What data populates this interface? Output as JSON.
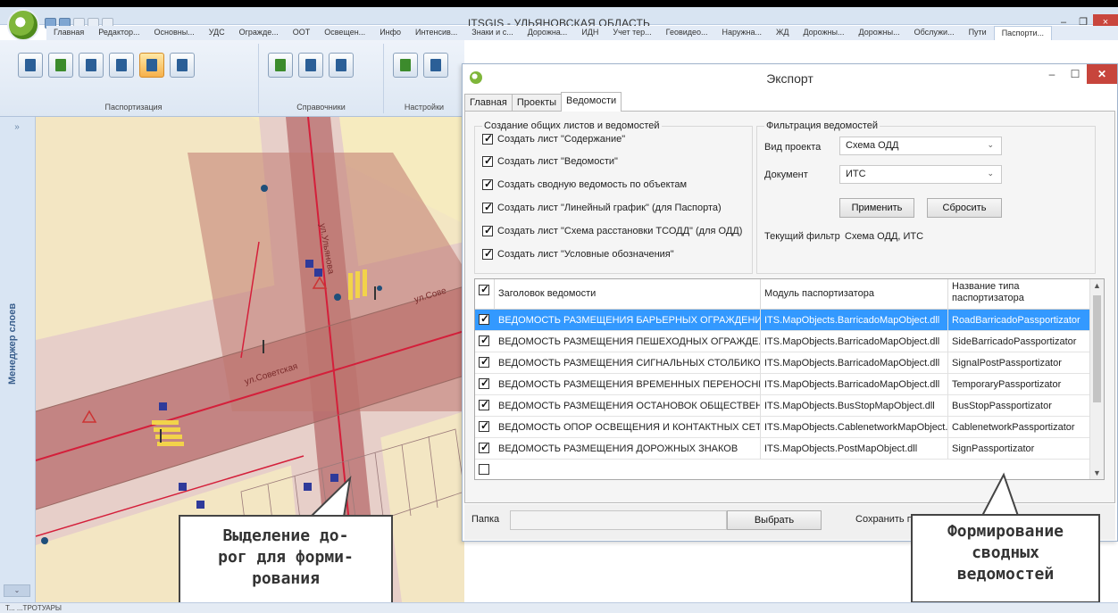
{
  "app": {
    "title": "ITSGIS - УЛЬЯНОВСКАЯ ОБЛАСТЬ",
    "window_controls": {
      "minimize": "–",
      "restore": "❐",
      "close": "×"
    }
  },
  "ribbon_tabs": [
    "Главная",
    "Редактор...",
    "Основны...",
    "УДС",
    "Огражде...",
    "ООТ",
    "Освещен...",
    "Инфо",
    "Интенсив...",
    "Знаки и с...",
    "Дорожна...",
    "ИДН",
    "Учет тер...",
    "Геовидео...",
    "Наружна...",
    "ЖД",
    "Дорожны...",
    "Дорожны...",
    "Обслужи...",
    "Пути",
    "Паспорти..."
  ],
  "ribbon_groups": {
    "passport": "Паспортизация",
    "refs": "Справочники",
    "settings": "Настройки"
  },
  "layers_panel": {
    "title": "Менеджер слоев",
    "toggle": "»"
  },
  "map": {
    "labels": {
      "street_ulyanova": "ул.Ульянова",
      "street_sovetskaya": "ул.Советская",
      "street_sove_right": "ул.Сове"
    }
  },
  "export_dialog": {
    "title": "Экспорт",
    "tabs": [
      "Главная",
      "Проекты",
      "Ведомости"
    ],
    "active_tab": "Ведомости",
    "common_group": {
      "legend": "Создание общих листов и ведомостей",
      "options": [
        {
          "label": "Создать лист \"Содержание\"",
          "checked": true
        },
        {
          "label": "Создать лист \"Ведомости\"",
          "checked": true
        },
        {
          "label": "Создать сводную ведомость по объектам",
          "checked": true
        },
        {
          "label": "Создать лист \"Линейный график\" (для Паспорта)",
          "checked": true
        },
        {
          "label": "Создать лист \"Схема расстановки ТСОДД\" (для ОДД)",
          "checked": true
        },
        {
          "label": "Создать лист \"Условные обозначения\"",
          "checked": true
        }
      ]
    },
    "filter_group": {
      "legend": "Фильтрация ведомостей",
      "project_type_label": "Вид проекта",
      "project_type_value": "Схема ОДД",
      "document_label": "Документ",
      "document_value": "ИТС",
      "apply_label": "Применить",
      "reset_label": "Сбросить",
      "current_filter_label": "Текущий фильтр",
      "current_filter_value": "Схема ОДД, ИТС"
    },
    "table": {
      "columns": [
        "Заголовок ведомости",
        "Модуль паспортизатора",
        "Название типа паспортизатора"
      ],
      "rows": [
        {
          "checked": true,
          "title": "ВЕДОМОСТЬ РАЗМЕЩЕНИЯ БАРЬЕРНЫХ ОГРАЖДЕНИЙ",
          "module": "ITS.MapObjects.BarricadoMapObject.dll",
          "type": "RoadBarricadoPassportizator",
          "selected": true
        },
        {
          "checked": true,
          "title": "ВЕДОМОСТЬ РАЗМЕЩЕНИЯ ПЕШЕХОДНЫХ ОГРАЖДЕ...",
          "module": "ITS.MapObjects.BarricadoMapObject.dll",
          "type": "SideBarricadoPassportizator"
        },
        {
          "checked": true,
          "title": "ВЕДОМОСТЬ РАЗМЕЩЕНИЯ СИГНАЛЬНЫХ СТОЛБИКОВ",
          "module": "ITS.MapObjects.BarricadoMapObject.dll",
          "type": "SignalPostPassportizator"
        },
        {
          "checked": true,
          "title": "ВЕДОМОСТЬ РАЗМЕЩЕНИЯ ВРЕМЕННЫХ ПЕРЕНОСНЫ...",
          "module": "ITS.MapObjects.BarricadoMapObject.dll",
          "type": "TemporaryPassportizator"
        },
        {
          "checked": true,
          "title": "ВЕДОМОСТЬ РАЗМЕЩЕНИЯ ОСТАНОВОК ОБЩЕСТВЕН...",
          "module": "ITS.MapObjects.BusStopMapObject.dll",
          "type": "BusStopPassportizator"
        },
        {
          "checked": true,
          "title": "ВЕДОМОСТЬ ОПОР ОСВЕЩЕНИЯ И КОНТАКТНЫХ СЕТЕЙ",
          "module": "ITS.MapObjects.CablenetworkMapObject.dll",
          "type": "CablenetworkPassportizator"
        },
        {
          "checked": true,
          "title": "ВЕДОМОСТЬ РАЗМЕЩЕНИЯ ДОРОЖНЫХ ЗНАКОВ",
          "module": "ITS.MapObjects.PostMapObject.dll",
          "type": "SignPassportizator"
        }
      ]
    },
    "footer": {
      "folder_label": "Папка",
      "browse_label": "Выбрать",
      "save_label": "Сохранить па"
    }
  },
  "callouts": {
    "left": [
      "Выделение до-",
      "рог для форми-",
      "рования"
    ],
    "right": [
      "Формирование",
      "сводных",
      "ведомостей"
    ]
  },
  "status_bar": {
    "text": "Т... ...ТРОТУАРЫ"
  },
  "colors": {
    "selection": "#3399ff",
    "close_button": "#c7453c",
    "ribbon_active": "#f6b14b",
    "road_highlight": "#b35a5a"
  }
}
